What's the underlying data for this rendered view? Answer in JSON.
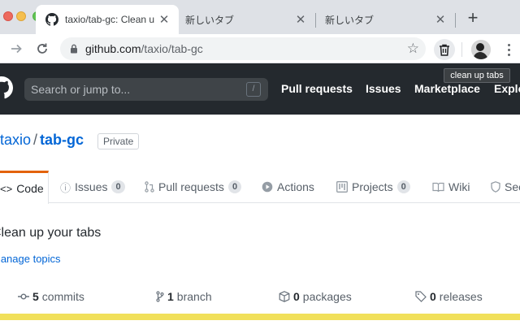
{
  "browser": {
    "tabs": [
      {
        "title": "taxio/tab-gc: Clean up your tabs",
        "active": true
      },
      {
        "title": "新しいタブ",
        "active": false
      },
      {
        "title": "新しいタブ",
        "active": false
      }
    ],
    "close_glyph": "✕",
    "newtab_glyph": "+",
    "url_host": "github.com",
    "url_path": "/taxio/tab-gc",
    "star_glyph": "☆",
    "extension_tooltip": "clean up tabs"
  },
  "github": {
    "search_placeholder": "Search or jump to...",
    "search_key": "/",
    "nav": [
      "Pull requests",
      "Issues",
      "Marketplace",
      "Explore"
    ]
  },
  "repo": {
    "owner": "taxio",
    "separator": "/",
    "name": "tab-gc",
    "visibility": "Private",
    "tabs": [
      {
        "label": "Code"
      },
      {
        "label": "Issues",
        "count": "0"
      },
      {
        "label": "Pull requests",
        "count": "0"
      },
      {
        "label": "Actions"
      },
      {
        "label": "Projects",
        "count": "0"
      },
      {
        "label": "Wiki"
      },
      {
        "label": "Security"
      }
    ],
    "description": "Clean up your tabs",
    "topics_link": "Manage topics",
    "stats": {
      "commits_count": "5",
      "commits_label": "commits",
      "branch_count": "1",
      "branch_label": "branch",
      "packages_count": "0",
      "packages_label": "packages",
      "releases_count": "0",
      "releases_label": "releases"
    }
  },
  "colors": {
    "header_bg": "#24292e",
    "link_blue": "#0366d6",
    "selected_tab_accent": "#e36209",
    "language_bar": "#f1e05a"
  }
}
